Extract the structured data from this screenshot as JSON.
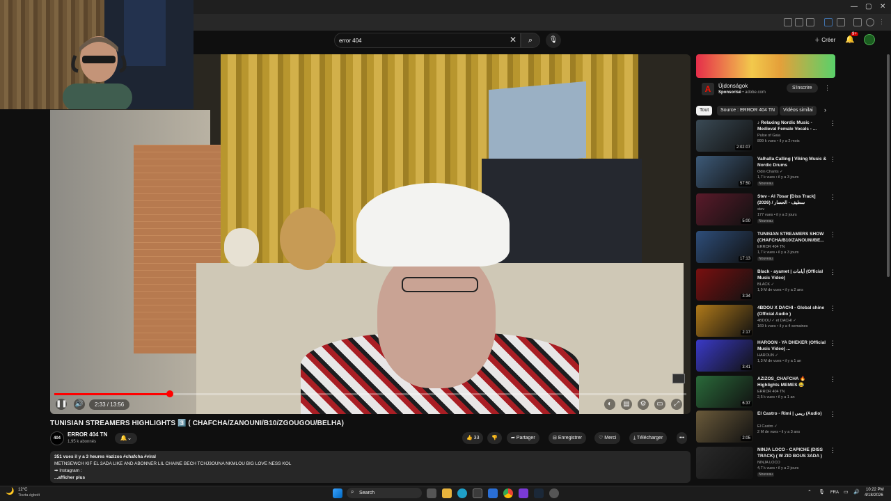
{
  "search": {
    "value": "error 404"
  },
  "header": {
    "create_label": "Créer",
    "notif_badge": "9+"
  },
  "video": {
    "title": "TUNISIAN STREAMERS HIGHLIGHTS 3️⃣ ( CHAFCHA/ZANOUNI/B10/ZGOUGOU/BELHA)",
    "time": "2:33 / 13:56",
    "progress": 0.183
  },
  "channel": {
    "name": "ERROR 404 TN",
    "subs": "1,95 k abonnés",
    "avatar_text": "404"
  },
  "actions": {
    "likes": "33",
    "share": "Partager",
    "save": "Enregistrer",
    "thanks": "Merci",
    "download": "Télécharger"
  },
  "description": {
    "meta": "351 vues  il y a 3 heures  #azizos #chafcha #viral",
    "line1": "METNSEWCH KIF EL 3ADA LIKE AND ABONNER LIL CHAINE BECH TCHJ3OUNA NKMLOU BIG LOVE NESS KOL",
    "line2": "➡ Instagram :",
    "more": "...afficher plus"
  },
  "ad": {
    "title": "Újdonságok",
    "sponsor": "Sponsorisé",
    "domain": "adobe.com",
    "button": "S'inscrire"
  },
  "chips": [
    "Tout",
    "Source : ERROR 404 TN",
    "Vidéos similai"
  ],
  "recommendations": [
    {
      "title": "♪ Relaxing Nordic Music - Medieval Female Vocals - ...",
      "channel": "Pulse of Gaia",
      "meta": "899 k vues • il y a 2 mois",
      "duration": "2:02:07",
      "thumb_color": "#3a4a55",
      "new": ""
    },
    {
      "title": "Valhalla Calling | Viking Music & Nordic Drums",
      "channel": "Odin Chants ✓",
      "meta": "1,7 k vues • il y a 3 jours",
      "duration": "57:50",
      "thumb_color": "#3d5a78",
      "new": "Nouveau"
    },
    {
      "title": "Stev - Al 7bsar [Diss Track] (2026) / سطيف - الحصار",
      "channel": "stev",
      "meta": "177 vues • il y a 3 jours",
      "duration": "5:00",
      "thumb_color": "#5a1a2a",
      "new": "Nouveau"
    },
    {
      "title": "TUNISIAN STREAMERS SHOW (CHAFCHA/B10/ZANOUNI/BE...",
      "channel": "ERROR 404 TN",
      "meta": "1,7 k vues • il y a 3 jours",
      "duration": "17:13",
      "thumb_color": "#2e4e7a",
      "new": "Nouveau"
    },
    {
      "title": "Black - ayamet | أيامات (Official Music Video)",
      "channel": "BLACK ✓",
      "meta": "1,9 M de vues • il y a 2 ans",
      "duration": "3:34",
      "thumb_color": "#7a1010",
      "new": ""
    },
    {
      "title": "4BDOU X DACHI - Global shine (Official Audio )",
      "channel": "4BDOU ✓ et DACHI ✓",
      "meta": "169 k vues • il y a 4 semaines",
      "duration": "2:17",
      "thumb_color": "#b07a1a",
      "new": ""
    },
    {
      "title": "HAROON - YA DHEKER (Official Music Video) ...",
      "channel": "HAROUN ✓",
      "meta": "1,3 M de vues • il y a 1 an",
      "duration": "3:41",
      "thumb_color": "#3a3ac8",
      "new": ""
    },
    {
      "title": "AZIZOS_CHAFCHA 🔥 Highlights MEMES 😂",
      "channel": "ERROR 404 TN",
      "meta": "2,5 k vues • il y a 1 an",
      "duration": "6:37",
      "thumb_color": "#2a6a3a",
      "new": ""
    },
    {
      "title": "El Castro - Rimi | ريمي (Audio)",
      "channel": "El Castro ✓",
      "meta": "2 M de vues • il y a 3 ans",
      "duration": "2:05",
      "thumb_color": "#6a5a3a",
      "new": ""
    },
    {
      "title": "NINJA LOCO - CAPICHE (DISS TRACK) ( W ZID BOUS 3ADA )",
      "channel": "NINJA LOCO",
      "meta": "4,7 k vues • il y a 2 jours",
      "duration": "",
      "thumb_color": "#2a2a2a",
      "new": "Nouveau"
    }
  ],
  "taskbar": {
    "search_label": "Search",
    "weather_temp": "12°C",
    "weather_desc": "Tiszta égbolt",
    "lang": "FRA",
    "time": "10:22 PM",
    "date": "4/18/2026"
  },
  "colors": {
    "accent": "#ff0000",
    "background": "#0f0f0f",
    "surface": "#272727"
  }
}
